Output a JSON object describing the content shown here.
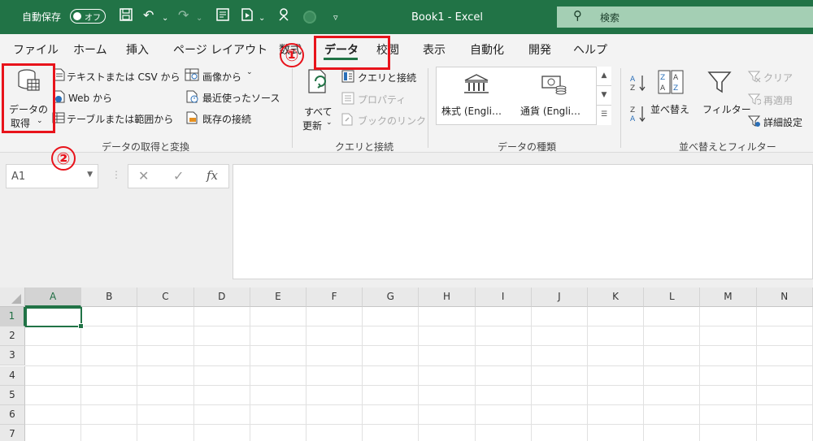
{
  "titlebar": {
    "autosave_label": "自動保存",
    "autosave_state": "オフ",
    "title": "Book1  -  Excel",
    "search_placeholder": "検索"
  },
  "tabs": [
    {
      "label": "ファイル"
    },
    {
      "label": "ホーム"
    },
    {
      "label": "挿入"
    },
    {
      "label": "ページ レイアウト"
    },
    {
      "label": "数式"
    },
    {
      "label": "データ"
    },
    {
      "label": "校閲"
    },
    {
      "label": "表示"
    },
    {
      "label": "自動化"
    },
    {
      "label": "開発"
    },
    {
      "label": "ヘルプ"
    }
  ],
  "ribbon": {
    "get_data": {
      "big_button_line1": "データの",
      "big_button_line2": "取得",
      "from_text_csv": "テキストまたは CSV から",
      "from_web": "Web から",
      "from_table": "テーブルまたは範囲から",
      "from_image": "画像から",
      "recent_sources": "最近使ったソース",
      "existing_connections": "既存の接続",
      "group_label": "データの取得と変換"
    },
    "queries": {
      "refresh_line1": "すべて",
      "refresh_line2": "更新",
      "queries_connections": "クエリと接続",
      "properties": "プロパティ",
      "edit_links": "ブックのリンク",
      "group_label": "クエリと接続"
    },
    "data_types": {
      "stocks": "株式 (Engli…",
      "currencies": "通貨 (Engli…",
      "group_label": "データの種類"
    },
    "sort_filter": {
      "sort": "並べ替え",
      "filter": "フィルター",
      "clear": "クリア",
      "reapply": "再適用",
      "advanced": "詳細設定",
      "group_label": "並べ替えとフィルター"
    }
  },
  "annotations": {
    "step1": "①",
    "step2": "②",
    "color": "#e8131b"
  },
  "formula_bar": {
    "name_box": "A1",
    "fx": "fx",
    "value": ""
  },
  "grid": {
    "columns": [
      "A",
      "B",
      "C",
      "D",
      "E",
      "F",
      "G",
      "H",
      "I",
      "J",
      "K",
      "L",
      "M",
      "N"
    ],
    "rows": [
      "1",
      "2",
      "3",
      "4",
      "5",
      "6",
      "7"
    ],
    "active_cell": "A1"
  },
  "colors": {
    "excel_green": "#217346",
    "ribbon_bg": "#f3f3f3"
  }
}
